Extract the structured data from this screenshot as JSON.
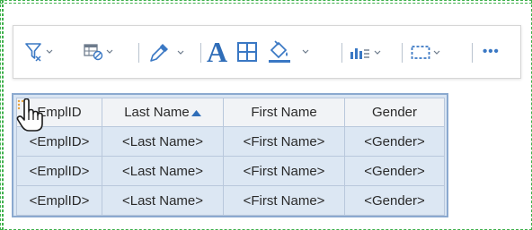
{
  "toolbar": {
    "items": [
      {
        "name": "filter-icon"
      },
      {
        "name": "table-style-icon"
      },
      {
        "name": "eyedropper-icon"
      },
      {
        "name": "font-icon",
        "label": "A"
      },
      {
        "name": "borders-icon"
      },
      {
        "name": "fill-color-icon"
      },
      {
        "name": "chart-icon"
      },
      {
        "name": "selection-icon"
      },
      {
        "name": "more-icon",
        "label": "•••"
      }
    ]
  },
  "table": {
    "headers": [
      "EmplID",
      "Last Name",
      "First Name",
      "Gender"
    ],
    "sorted_column": "Last Name",
    "sort_direction": "ascending",
    "rows": [
      [
        "<EmplID>",
        "<Last Name>",
        "<First Name>",
        "<Gender>"
      ],
      [
        "<EmplID>",
        "<Last Name>",
        "<First Name>",
        "<Gender>"
      ],
      [
        "<EmplID>",
        "<Last Name>",
        "<First Name>",
        "<Gender>"
      ]
    ]
  },
  "colors": {
    "accent": "#3a78c4",
    "selection_border": "#8ba9cf",
    "table_bg": "#d9e5f3",
    "guide": "#3db04a",
    "handle": "#e8a33d"
  }
}
